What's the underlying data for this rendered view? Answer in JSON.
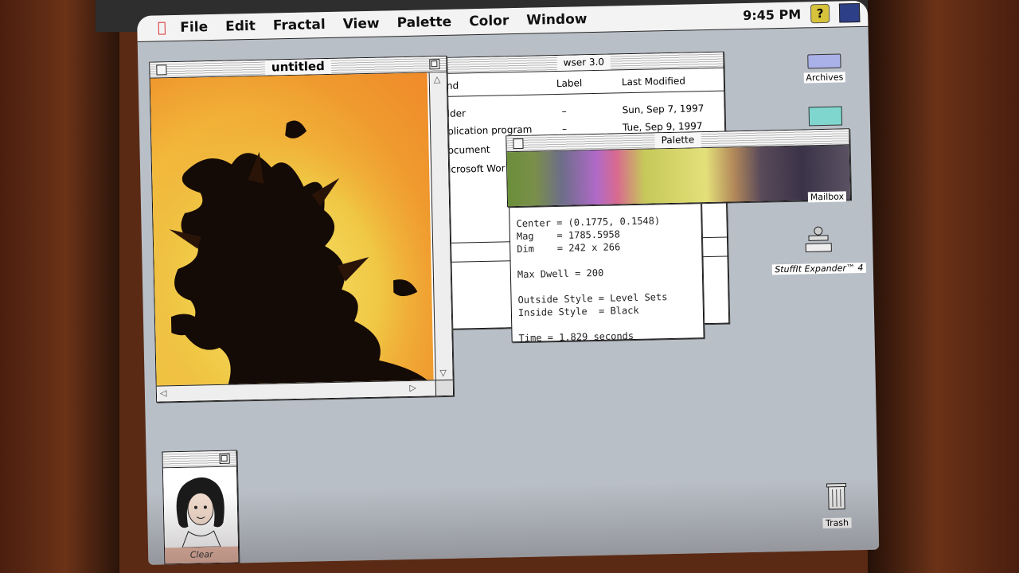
{
  "menubar": {
    "apple_icon": "apple-logo",
    "items": [
      "File",
      "Edit",
      "Fractal",
      "View",
      "Palette",
      "Color",
      "Window"
    ],
    "clock": "9:45 PM",
    "help_icon": "?"
  },
  "fractal_window": {
    "title": "untitled"
  },
  "finder_window": {
    "title_fragment": "wser 3.0",
    "columns": [
      "nd",
      "Label",
      "Last Modified"
    ],
    "rows": [
      {
        "kind": "lder",
        "label": "–",
        "modified": "Sun, Sep 7, 1997"
      },
      {
        "kind": "plication program",
        "label": "–",
        "modified": "Tue, Sep 9, 1997"
      },
      {
        "kind": "ocument",
        "label": "",
        "modified": ""
      },
      {
        "kind": "icrosoft Wor",
        "label": "",
        "modified": ""
      }
    ]
  },
  "palette_window": {
    "title": "Palette"
  },
  "info_window": {
    "lines": [
      "Center = (0.1775, 0.1548)",
      "Mag    = 1785.5958",
      "Dim    = 242 x 266",
      "",
      "Max Dwell = 200",
      "",
      "Outside Style = Level Sets",
      "Inside Style  = Black",
      "",
      "Time = 1.829 seconds"
    ]
  },
  "desktop_icons": {
    "archives": "Archives",
    "mailbox": "Mailbox",
    "stuffit": "StuffIt Expander™ 4",
    "trash": "Trash"
  },
  "avatar_window": {
    "label": "Clear"
  }
}
